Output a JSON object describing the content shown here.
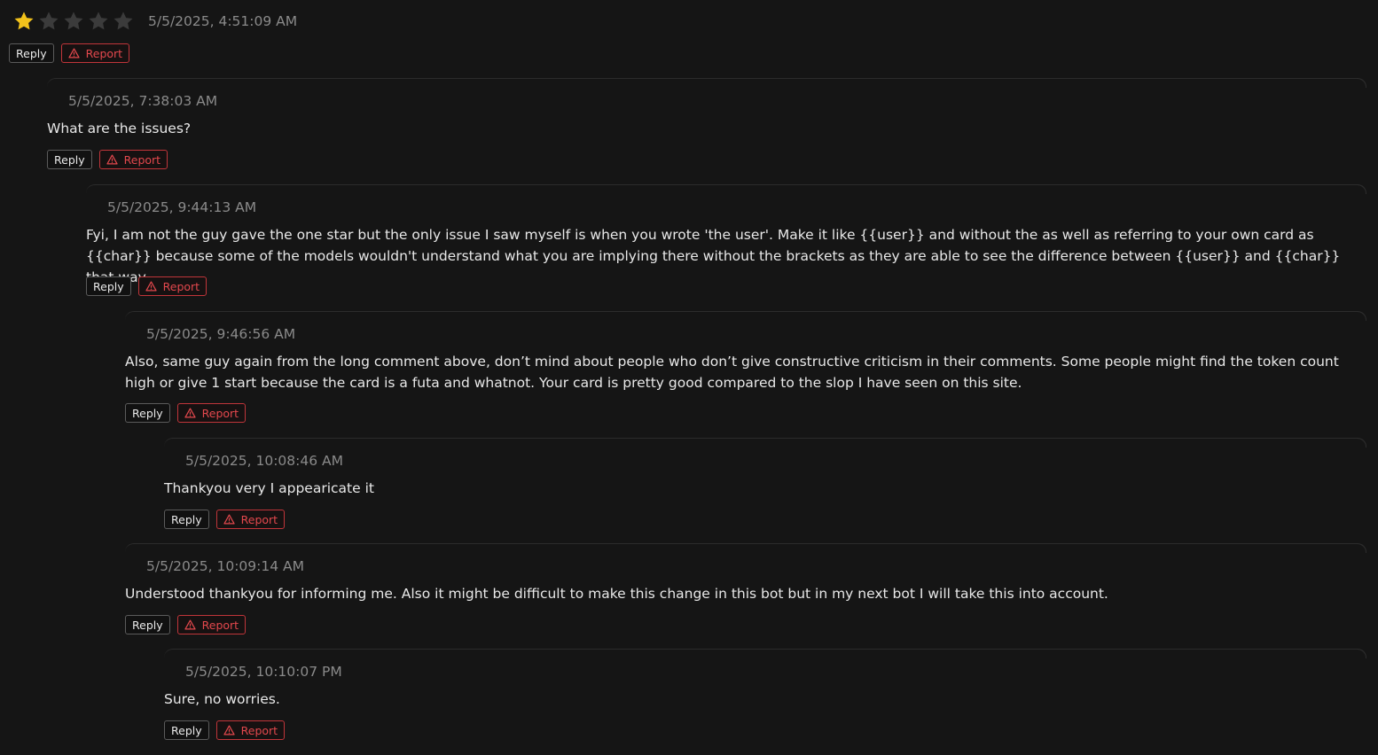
{
  "root": {
    "rating": 1,
    "max_rating": 5,
    "timestamp": "5/5/2025, 4:51:09 AM",
    "reply_label": "Reply",
    "report_label": "Report"
  },
  "replies": [
    {
      "timestamp": "5/5/2025, 7:38:03 AM",
      "text": "What are the issues?",
      "reply_label": "Reply",
      "report_label": "Report"
    },
    {
      "timestamp": "5/5/2025, 9:44:13 AM",
      "text": "Fyi, I am not the guy gave the one star but the only issue I saw myself is when you wrote 'the user'. Make it like {{user}} and without the as well as referring to your own card as {{char}} because some of the models wouldn't understand what you are implying there without the brackets as they are able to see the difference between {{user}} and {{char}} that way.",
      "reply_label": "Reply",
      "report_label": "Report"
    },
    {
      "timestamp": "5/5/2025, 9:46:56 AM",
      "text": "Also, same guy again from the long comment above, don’t mind about people who don’t give constructive criticism in their comments. Some people might find the token count high or give 1 start because the card is a futa and whatnot. Your card is pretty good compared to the slop I have seen on this site.",
      "reply_label": "Reply",
      "report_label": "Report"
    },
    {
      "timestamp": "5/5/2025, 10:08:46 AM",
      "text": "Thankyou very I appearicate it",
      "reply_label": "Reply",
      "report_label": "Report"
    },
    {
      "timestamp": "5/5/2025, 10:09:14 AM",
      "text": "Understood thankyou for informing me. Also it might be difficult to make this change in this bot but in my next bot I will take this into account.",
      "reply_label": "Reply",
      "report_label": "Report"
    },
    {
      "timestamp": "5/5/2025, 10:10:07 PM",
      "text": "Sure, no worries.",
      "reply_label": "Reply",
      "report_label": "Report"
    }
  ],
  "colors": {
    "background": "#151515",
    "star_filled": "#f2c21b",
    "star_empty": "#3b3b3b",
    "report_accent": "#e3484d",
    "timestamp": "#8a8a8a"
  },
  "icons": {
    "rating_star": "star-icon",
    "report": "warning-triangle-icon"
  }
}
